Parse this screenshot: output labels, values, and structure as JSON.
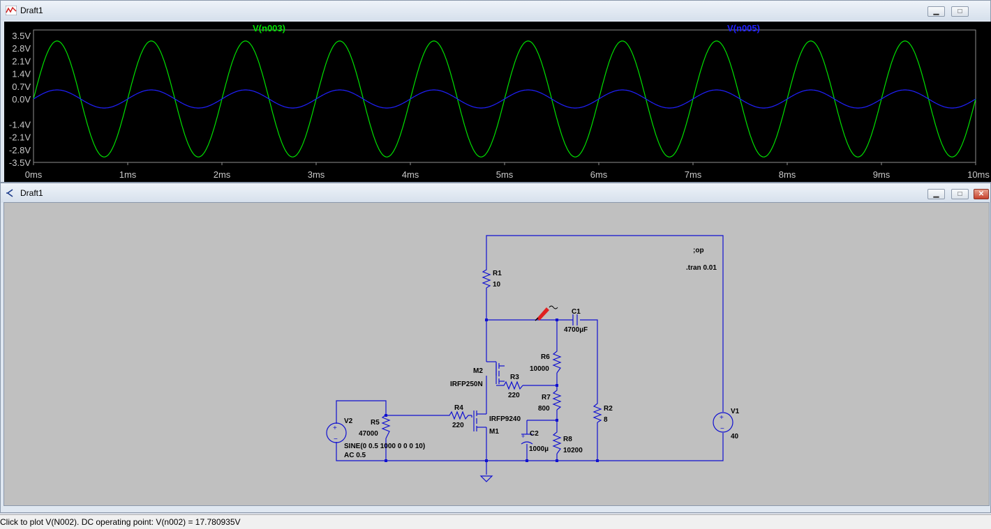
{
  "waveform_window": {
    "title": "Draft1",
    "chart_data": {
      "type": "line",
      "xlabel": "",
      "ylabel": "",
      "xlim": [
        0,
        10
      ],
      "ylim": [
        -3.5,
        3.5
      ],
      "x_ticks": [
        "0ms",
        "1ms",
        "2ms",
        "3ms",
        "4ms",
        "5ms",
        "6ms",
        "7ms",
        "8ms",
        "9ms",
        "10ms"
      ],
      "y_ticks": [
        "3.5V",
        "2.8V",
        "2.1V",
        "1.4V",
        "0.7V",
        "0.0V",
        "-1.4V",
        "-2.1V",
        "-2.8V",
        "-3.5V"
      ],
      "series": [
        {
          "name": "V(n003)",
          "color": "#00e000",
          "amplitude": 3.2,
          "frequency_khz": 1,
          "x_start_ms": 0,
          "x_end_ms": 10
        },
        {
          "name": "V(n005)",
          "color": "#2020ff",
          "amplitude": 0.5,
          "frequency_khz": 1,
          "x_start_ms": 0,
          "x_end_ms": 10
        }
      ],
      "grid": false
    }
  },
  "schematic_window": {
    "title": "Draft1",
    "directives": [
      ";op",
      ".tran 0.01"
    ],
    "components": {
      "R1": {
        "name": "R1",
        "value": "10"
      },
      "C1": {
        "name": "C1",
        "value": "4700µF"
      },
      "R6": {
        "name": "R6",
        "value": "10000"
      },
      "M2": {
        "name": "M2",
        "value": "IRFP250N"
      },
      "R3": {
        "name": "R3",
        "value": "220"
      },
      "R7": {
        "name": "R7",
        "value": "800"
      },
      "R4": {
        "name": "R4",
        "value": "220"
      },
      "M1": {
        "name": "M1",
        "value": "IRFP9240"
      },
      "C2": {
        "name": "C2",
        "value": "1000µ"
      },
      "R8": {
        "name": "R8",
        "value": "10200"
      },
      "R2": {
        "name": "R2",
        "value": "8"
      },
      "R5": {
        "name": "R5",
        "value": "47000"
      },
      "V2": {
        "name": "V2",
        "value": "SINE(0 0.5 1000 0 0 0 10)",
        "value2": "AC 0.5"
      },
      "V1": {
        "name": "V1",
        "value": "40"
      }
    }
  },
  "window_buttons": {
    "minimize": "▁",
    "maximize": "□",
    "close": "✕"
  },
  "status": {
    "text": "Click to plot V(N002).  DC operating point: V(n002) = 17.780935V"
  }
}
